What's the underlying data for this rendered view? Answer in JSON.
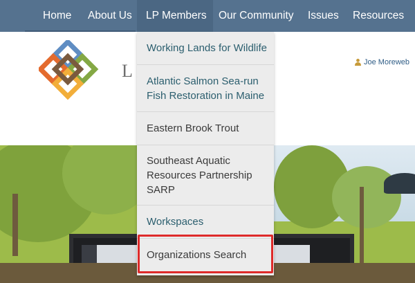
{
  "nav": {
    "items": [
      {
        "label": "Home"
      },
      {
        "label": "About Us"
      },
      {
        "label": "LP Members"
      },
      {
        "label": "Our Community"
      },
      {
        "label": "Issues"
      },
      {
        "label": "Resources"
      }
    ]
  },
  "header": {
    "site_name_partial": "L/",
    "user_name": "Joe Moreweb"
  },
  "dropdown": {
    "items": [
      {
        "label": "Working Lands for Wildlife"
      },
      {
        "label": "Atlantic Salmon Sea-run Fish Restoration in Maine"
      },
      {
        "label": "Eastern Brook Trout"
      },
      {
        "label": "Southeast Aquatic Resources Partnership SARP"
      },
      {
        "label": "Workspaces"
      },
      {
        "label": "Organizations Search"
      }
    ],
    "highlighted_item": "Organizations Search"
  },
  "colors": {
    "nav_bg": "#55728f",
    "link": "#2b5e6e",
    "highlight": "#de2a2a"
  }
}
